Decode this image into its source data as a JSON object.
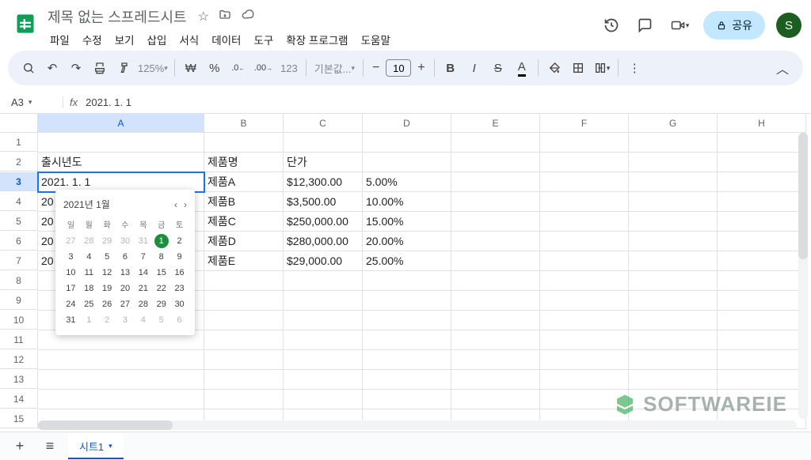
{
  "header": {
    "doc_title": "제목 없는 스프레드시트",
    "menus": [
      "파일",
      "수정",
      "보기",
      "삽입",
      "서식",
      "데이터",
      "도구",
      "확장 프로그램",
      "도움말"
    ],
    "share_label": "공유",
    "avatar_initial": "S"
  },
  "toolbar": {
    "zoom": "125%",
    "currency": "₩",
    "percent": "%",
    "dec_dec": ".0",
    "inc_dec": ".00",
    "num_fmt": "123",
    "font_family": "기본값...",
    "font_size": "10"
  },
  "formula_bar": {
    "cell_ref": "A3",
    "fx": "fx",
    "value": "2021. 1. 1"
  },
  "columns": [
    "A",
    "B",
    "C",
    "D",
    "E",
    "F",
    "G",
    "H"
  ],
  "row_numbers": [
    1,
    2,
    3,
    4,
    5,
    6,
    7,
    8,
    9,
    10,
    11,
    12,
    13,
    14,
    15
  ],
  "table": {
    "headers": {
      "a": "출시년도",
      "b": "제품명",
      "c": "단가"
    },
    "rows": [
      {
        "a": "2021. 1. 1",
        "b": "제품A",
        "c": "$12,300.00",
        "d": "5.00%"
      },
      {
        "a": "20",
        "b": "제품B",
        "c": "$3,500.00",
        "d": "10.00%"
      },
      {
        "a": "20",
        "b": "제품C",
        "c": "$250,000.00",
        "d": "15.00%"
      },
      {
        "a": "20",
        "b": "제품D",
        "c": "$280,000.00",
        "d": "20.00%"
      },
      {
        "a": "20",
        "b": "제품E",
        "c": "$29,000.00",
        "d": "25.00%"
      }
    ]
  },
  "datepicker": {
    "title": "2021년 1월",
    "dow": [
      "일",
      "월",
      "화",
      "수",
      "목",
      "금",
      "토"
    ],
    "weeks": [
      [
        {
          "d": 27,
          "o": 1
        },
        {
          "d": 28,
          "o": 1
        },
        {
          "d": 29,
          "o": 1
        },
        {
          "d": 30,
          "o": 1
        },
        {
          "d": 31,
          "o": 1
        },
        {
          "d": 1,
          "sel": 1
        },
        {
          "d": 2
        }
      ],
      [
        {
          "d": 3
        },
        {
          "d": 4
        },
        {
          "d": 5
        },
        {
          "d": 6
        },
        {
          "d": 7
        },
        {
          "d": 8
        },
        {
          "d": 9
        }
      ],
      [
        {
          "d": 10
        },
        {
          "d": 11
        },
        {
          "d": 12
        },
        {
          "d": 13
        },
        {
          "d": 14
        },
        {
          "d": 15
        },
        {
          "d": 16
        }
      ],
      [
        {
          "d": 17
        },
        {
          "d": 18
        },
        {
          "d": 19
        },
        {
          "d": 20
        },
        {
          "d": 21
        },
        {
          "d": 22
        },
        {
          "d": 23
        }
      ],
      [
        {
          "d": 24
        },
        {
          "d": 25
        },
        {
          "d": 26
        },
        {
          "d": 27
        },
        {
          "d": 28
        },
        {
          "d": 29
        },
        {
          "d": 30
        }
      ],
      [
        {
          "d": 31
        },
        {
          "d": 1,
          "o": 1
        },
        {
          "d": 2,
          "o": 1
        },
        {
          "d": 3,
          "o": 1
        },
        {
          "d": 4,
          "o": 1
        },
        {
          "d": 5,
          "o": 1
        },
        {
          "d": 6,
          "o": 1
        }
      ]
    ]
  },
  "sheet_tab": "시트1",
  "watermark": "SOFTWAREIE"
}
